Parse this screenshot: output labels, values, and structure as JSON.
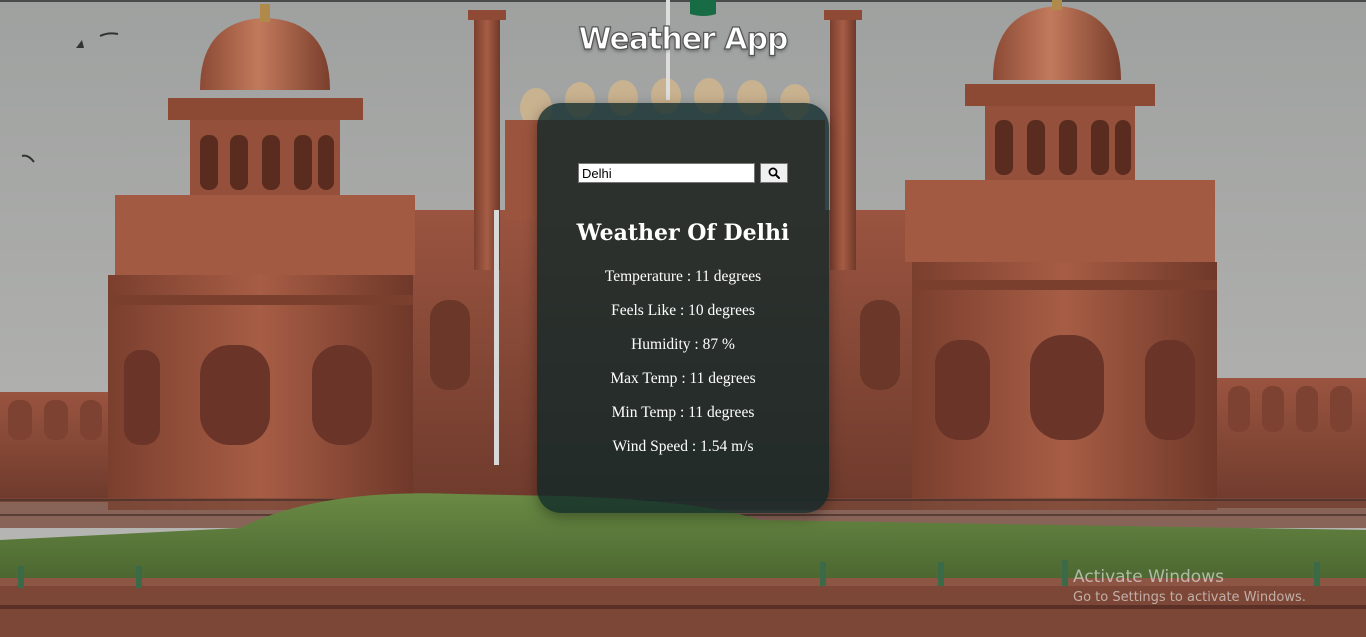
{
  "app": {
    "title": "Weather App"
  },
  "search": {
    "value": "Delhi",
    "button_icon": "search-icon"
  },
  "weather": {
    "heading": "Weather Of Delhi",
    "separator": " : ",
    "stats": [
      {
        "label": "Temperature",
        "value": "11 degrees"
      },
      {
        "label": "Feels Like",
        "value": "10 degrees"
      },
      {
        "label": "Humidity",
        "value": "87 %"
      },
      {
        "label": "Max Temp",
        "value": "11 degrees"
      },
      {
        "label": "Min Temp",
        "value": "11 degrees"
      },
      {
        "label": "Wind Speed",
        "value": "1.54 m/s"
      }
    ]
  },
  "watermark": {
    "title": "Activate Windows",
    "subtitle": "Go to Settings to activate Windows."
  },
  "colors": {
    "sky": "#a9abaa",
    "fort_red": "#8a4634",
    "grass": "#5d7d3a",
    "card_bg": "#0a2628"
  }
}
